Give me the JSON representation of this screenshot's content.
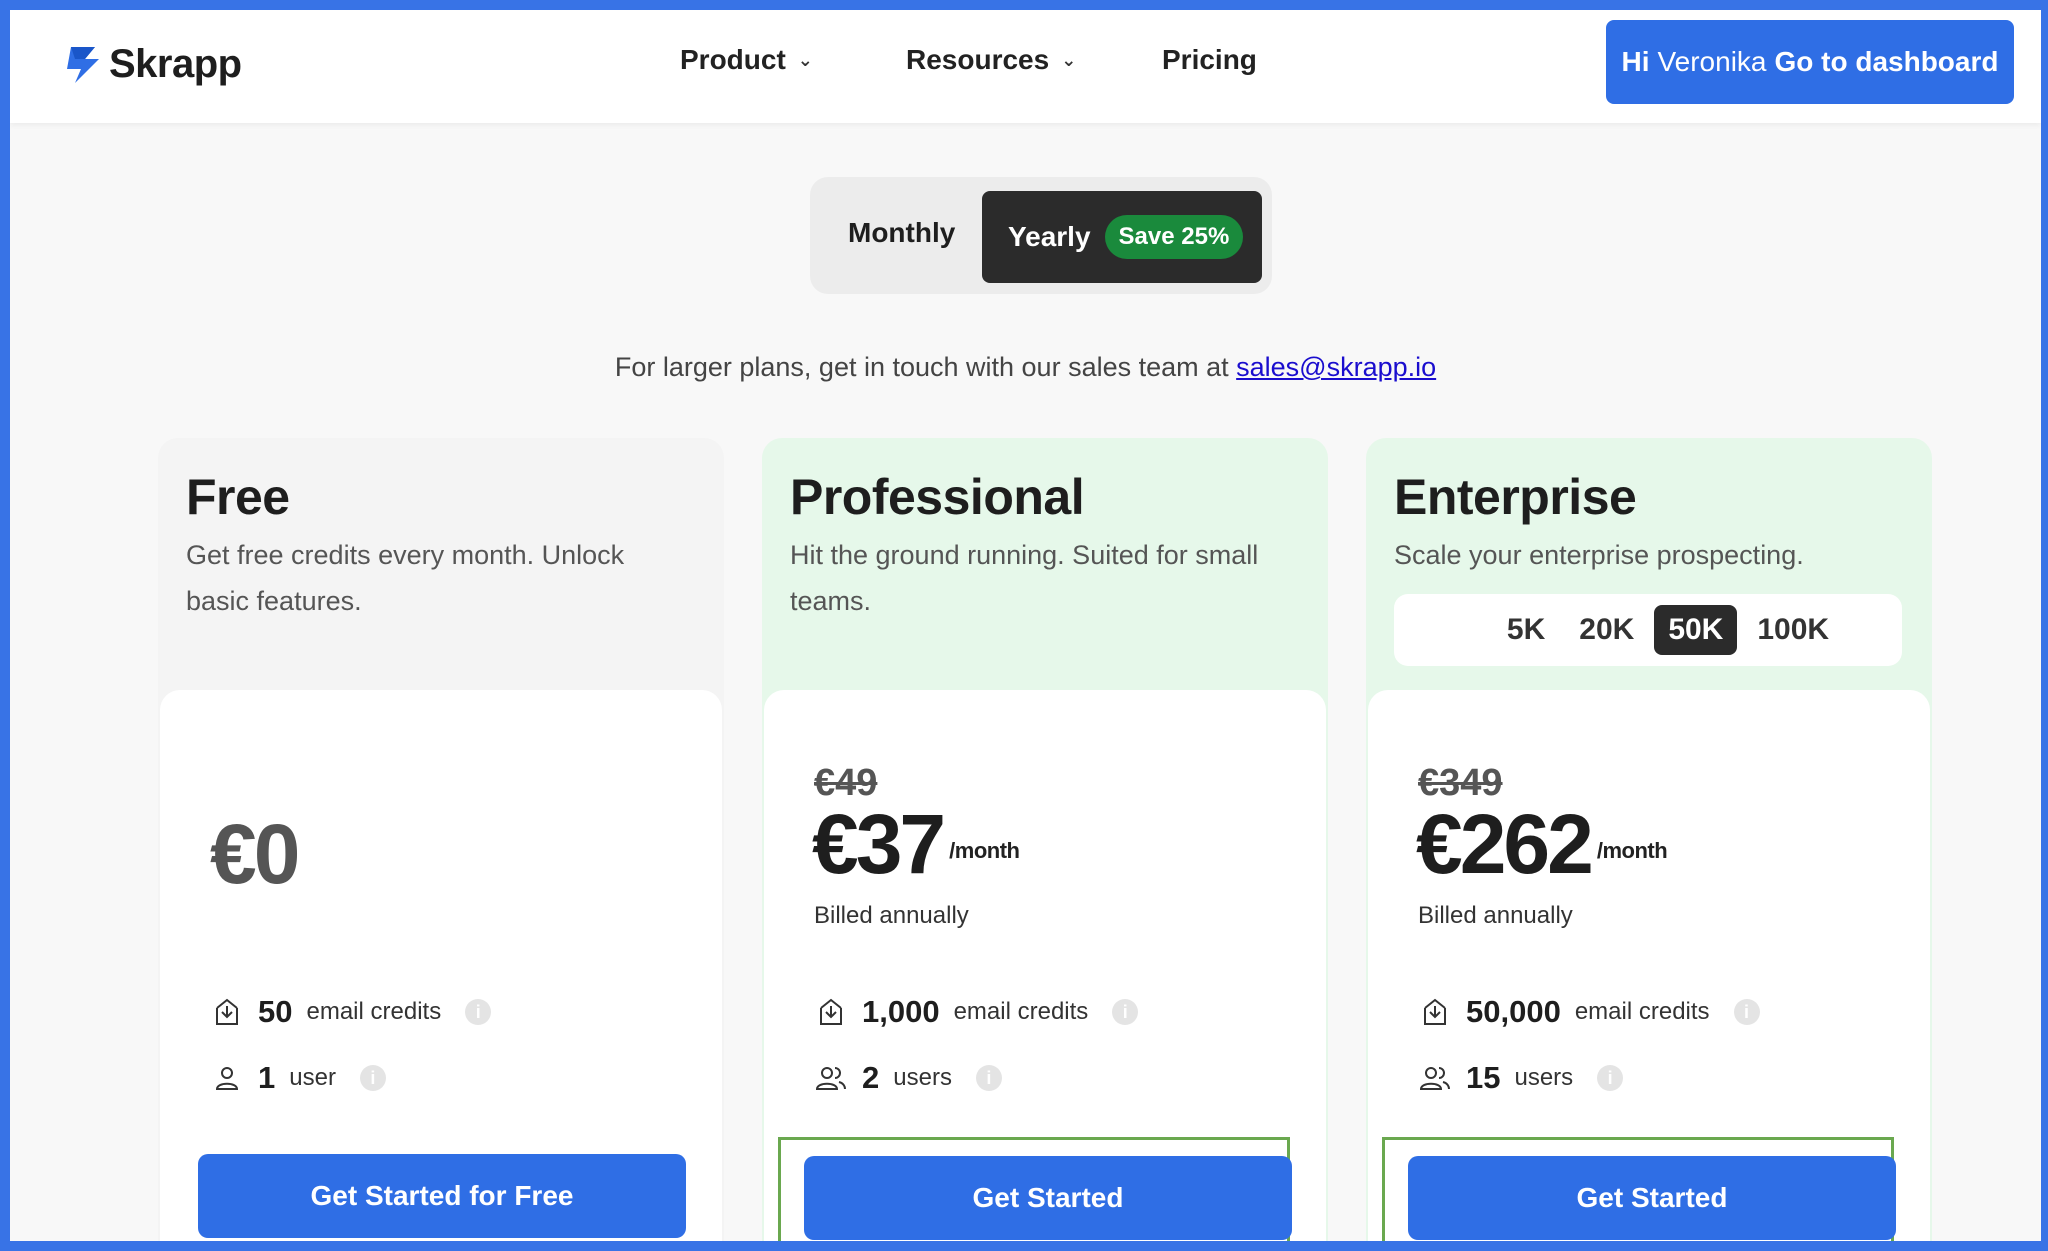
{
  "header": {
    "brand": "Skrapp",
    "nav": [
      {
        "label": "Product",
        "has_dropdown": true
      },
      {
        "label": "Resources",
        "has_dropdown": true
      },
      {
        "label": "Pricing",
        "has_dropdown": false
      }
    ],
    "dashboard_button": {
      "hi": "Hi",
      "name": "Veronika",
      "action": "Go to dashboard"
    }
  },
  "billing_toggle": {
    "monthly_label": "Monthly",
    "yearly_label": "Yearly",
    "save_badge": "Save 25%",
    "selected": "Yearly"
  },
  "sales_note": {
    "text": "For larger plans, get in touch with our sales team at ",
    "email": "sales@skrapp.io"
  },
  "plans": {
    "free": {
      "name": "Free",
      "description": "Get free credits every month. Unlock basic features.",
      "price": "€0",
      "credits_num": "50",
      "credits_label": "email credits",
      "users_num": "1",
      "users_label": "user",
      "cta": "Get Started for Free"
    },
    "professional": {
      "name": "Professional",
      "description": "Hit the ground running. Suited for small teams.",
      "old_price": "€49",
      "price": "€37",
      "per": "/month",
      "billed": "Billed annually",
      "credits_num": "1,000",
      "credits_label": "email credits",
      "users_num": "2",
      "users_label": "users",
      "cta": "Get Started"
    },
    "enterprise": {
      "name": "Enterprise",
      "description": "Scale your enterprise prospecting.",
      "volume_options": [
        "5K",
        "20K",
        "50K",
        "100K"
      ],
      "volume_selected": "50K",
      "old_price": "€349",
      "price": "€262",
      "per": "/month",
      "billed": "Billed annually",
      "credits_num": "50,000",
      "credits_label": "email credits",
      "users_num": "15",
      "users_label": "users",
      "cta": "Get Started"
    }
  },
  "colors": {
    "accent_blue": "#2f6ee5",
    "save_green": "#1a8a3c",
    "highlight_green": "#6aa84f",
    "card_green": "#e6f8ea",
    "dark": "#2b2b2b"
  }
}
